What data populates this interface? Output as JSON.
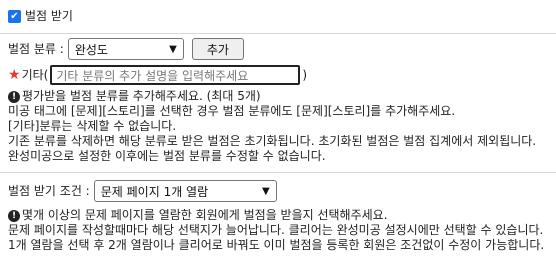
{
  "top": {
    "checkbox_label": "벌점 받기"
  },
  "category": {
    "label": "벌점 분류 :",
    "selected": "완성도",
    "add_button": "추가"
  },
  "etc": {
    "label_prefix": "기타",
    "open_paren": "(",
    "placeholder": "기타 분류의 추가 설명을 입력해주세요",
    "close_paren": ")"
  },
  "category_notes": [
    "평가받을 벌점 분류를 추가해주세요. (최대 5개)",
    "미공 태그에 [문제][스토리]를 선택한 경우 벌점 분류에도 [문제][스토리]를 추가해주세요.",
    "[기타]분류는 삭제할 수 없습니다.",
    "기존 분류를 삭제하면 해당 분류로 받은 벌점은 초기화됩니다. 초기화된 벌점은 벌점 집계에서 제외됩니다.",
    "완성미공으로 설정한 이후에는 벌점 분류를 수정할 수 없습니다."
  ],
  "condition": {
    "label": "벌점 받기 조건 :",
    "selected": "문제 페이지 1개 열람"
  },
  "condition_notes": [
    "몇개 이상의 문제 페이지를 열람한 회원에게 벌점을 받을지 선택해주세요.",
    "문제 페이지를 작성할때마다 해당 선택지가 늘어납니다. 클리어는 완성미공 설정시에만 선택할 수 있습니다.",
    "1개 열람을 선택 후 2개 열람이나 클리어로 바꿔도 이미 벌점을 등록한 회원은 조건없이 수정이 가능합니다."
  ],
  "icons": {
    "checkbox": "checkmark-icon",
    "star": "star-icon",
    "info": "info-icon",
    "dropdown": "chevron-down-icon"
  },
  "colors": {
    "accent": "#1a73e8",
    "required_star": "#e53935"
  }
}
